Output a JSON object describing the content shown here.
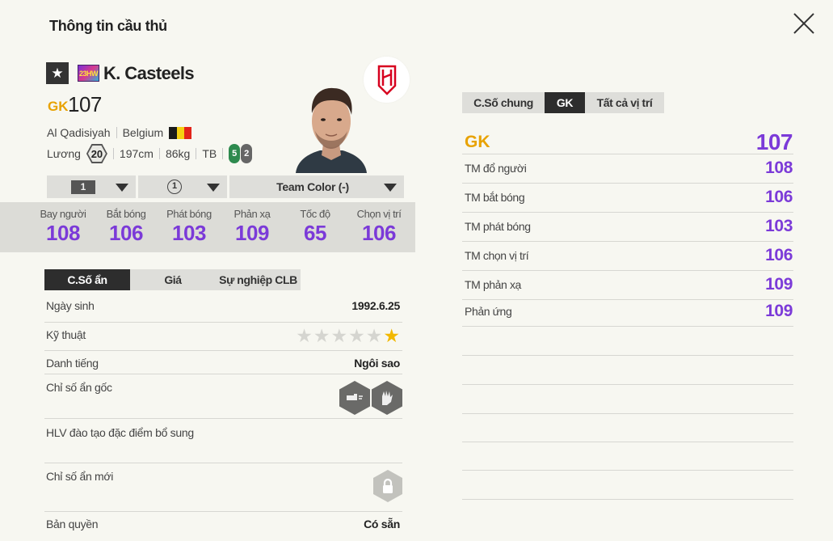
{
  "header": {
    "title": "Thông tin cầu thủ"
  },
  "player": {
    "name": "K. Casteels",
    "season_badge": "23HW",
    "position": "GK",
    "overall": "107",
    "club": "Al Qadisiyah",
    "nation": "Belgium",
    "flag_colors": [
      "#1a1a1a",
      "#f5d012",
      "#e2231a"
    ],
    "salary_label": "Lương",
    "salary": "20",
    "height": "197cm",
    "weight": "86kg",
    "body_type": "TB",
    "foot_right": "5",
    "foot_left": "2"
  },
  "selectors": {
    "level": "1",
    "grade": "1",
    "team_color": "Team Color (-)"
  },
  "face_stats": [
    {
      "label": "Bay người",
      "value": "108"
    },
    {
      "label": "Bắt bóng",
      "value": "106"
    },
    {
      "label": "Phát bóng",
      "value": "103"
    },
    {
      "label": "Phản xạ",
      "value": "109"
    },
    {
      "label": "Tốc độ",
      "value": "65"
    },
    {
      "label": "Chọn vị trí",
      "value": "106"
    }
  ],
  "left_tabs": [
    "C.Số ẩn",
    "Giá",
    "Sự nghiệp CLB"
  ],
  "info": {
    "birth_label": "Ngày sinh",
    "birth_value": "1992.6.25",
    "skill_label": "Kỹ thuật",
    "skill_stars": 1,
    "fame_label": "Danh tiếng",
    "fame_value": "Ngôi sao",
    "traits_label": "Chỉ số ẩn gốc",
    "coach_label": "HLV đào tạo đặc điểm bổ sung",
    "new_traits_label": "Chỉ số ẩn mới",
    "rights_label": "Bản quyền",
    "rights_value": "Có sẵn"
  },
  "right_tabs": [
    "C.Số chung",
    "GK",
    "Tất cả vị trí"
  ],
  "position_summary": {
    "label": "GK",
    "value": "107"
  },
  "detail_stats": [
    {
      "label": "TM đổ người",
      "value": "108"
    },
    {
      "label": "TM bắt bóng",
      "value": "106"
    },
    {
      "label": "TM phát bóng",
      "value": "103"
    },
    {
      "label": "TM chọn vị trí",
      "value": "106"
    },
    {
      "label": "TM phản xạ",
      "value": "109"
    },
    {
      "label": "Phản ứng",
      "value": "109"
    }
  ],
  "colors": {
    "accent_purple": "#7b3ad8",
    "position_gold": "#e8a200",
    "club_red": "#d7001f"
  }
}
